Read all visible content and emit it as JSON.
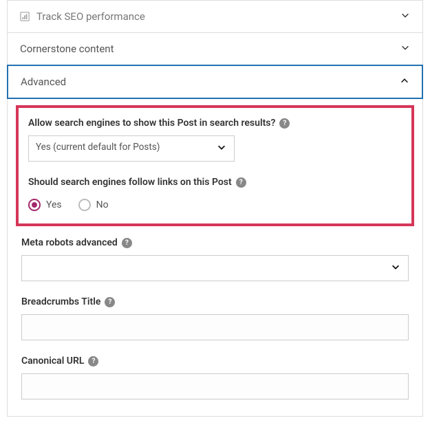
{
  "sections": {
    "seo": {
      "title": "Track SEO performance"
    },
    "cornerstone": {
      "title": "Cornerstone content"
    },
    "advanced": {
      "title": "Advanced"
    }
  },
  "advanced": {
    "allow_search": {
      "label": "Allow search engines to show this Post in search results?",
      "selected": "Yes (current default for Posts)"
    },
    "follow_links": {
      "label": "Should search engines follow links on this Post",
      "yes": "Yes",
      "no": "No"
    },
    "meta_robots": {
      "label": "Meta robots advanced",
      "value": ""
    },
    "breadcrumbs": {
      "label": "Breadcrumbs Title",
      "value": ""
    },
    "canonical": {
      "label": "Canonical URL",
      "value": ""
    }
  },
  "selected_follow": "yes"
}
